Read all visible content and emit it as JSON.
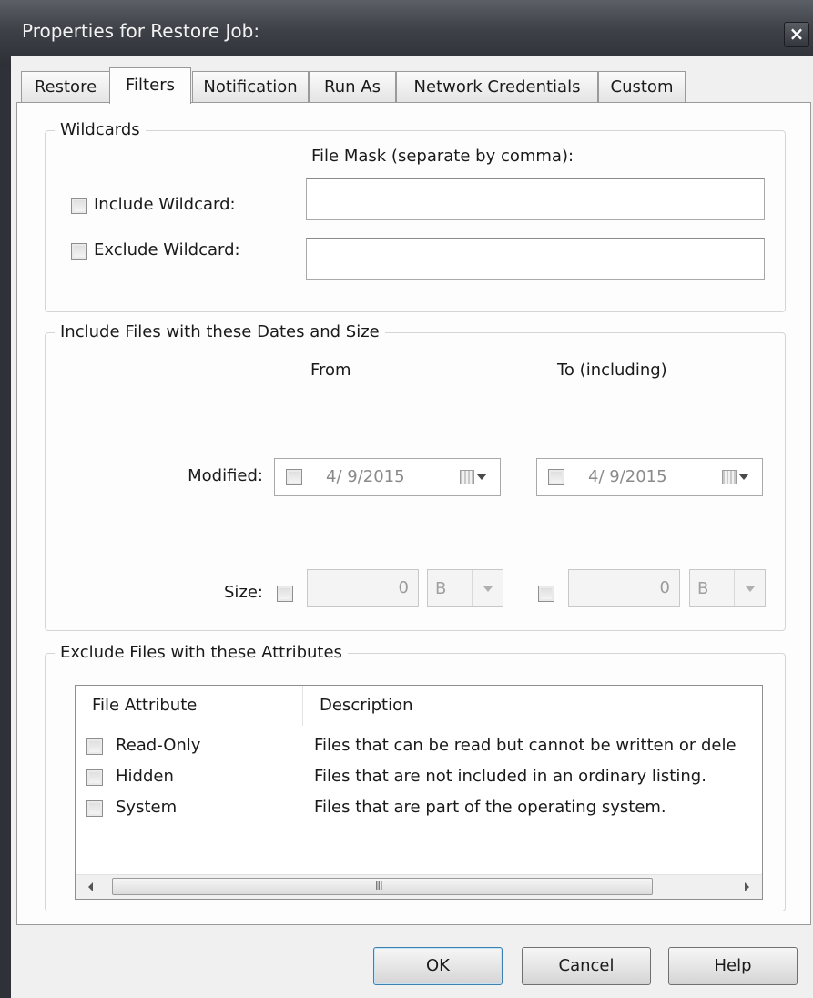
{
  "window": {
    "title": "Properties for Restore Job:",
    "close_label": "×"
  },
  "tabs": [
    {
      "label": "Restore",
      "active": false
    },
    {
      "label": "Filters",
      "active": true
    },
    {
      "label": "Notification",
      "active": false
    },
    {
      "label": "Run As",
      "active": false
    },
    {
      "label": "Network Credentials",
      "active": false
    },
    {
      "label": "Custom",
      "active": false
    }
  ],
  "wildcards": {
    "legend": "Wildcards",
    "file_mask_label": "File Mask (separate by comma):",
    "include_label": "Include Wildcard:",
    "include_checked": false,
    "include_value": "",
    "exclude_label": "Exclude Wildcard:",
    "exclude_checked": false,
    "exclude_value": ""
  },
  "dates_size": {
    "legend": "Include Files with these Dates and Size",
    "from_label": "From",
    "to_label": "To (including)",
    "modified_label": "Modified:",
    "from_date": "4/ 9/2015",
    "from_checked": false,
    "to_date": "4/ 9/2015",
    "to_checked": false,
    "size_label": "Size:",
    "from_size": "0",
    "from_size_checked": false,
    "from_unit": "B",
    "to_size": "0",
    "to_size_checked": false,
    "to_unit": "B"
  },
  "attributes": {
    "legend": "Exclude Files with these Attributes",
    "columns": [
      "File Attribute",
      "Description"
    ],
    "rows": [
      {
        "name": "Read-Only",
        "description": "Files that can be read but cannot be written or dele",
        "checked": false
      },
      {
        "name": "Hidden",
        "description": "Files that are not included in an ordinary listing.",
        "checked": false
      },
      {
        "name": "System",
        "description": "Files that are part of the operating system.",
        "checked": false
      }
    ],
    "scroll_grip": "III"
  },
  "buttons": {
    "ok": "OK",
    "cancel": "Cancel",
    "help": "Help"
  }
}
